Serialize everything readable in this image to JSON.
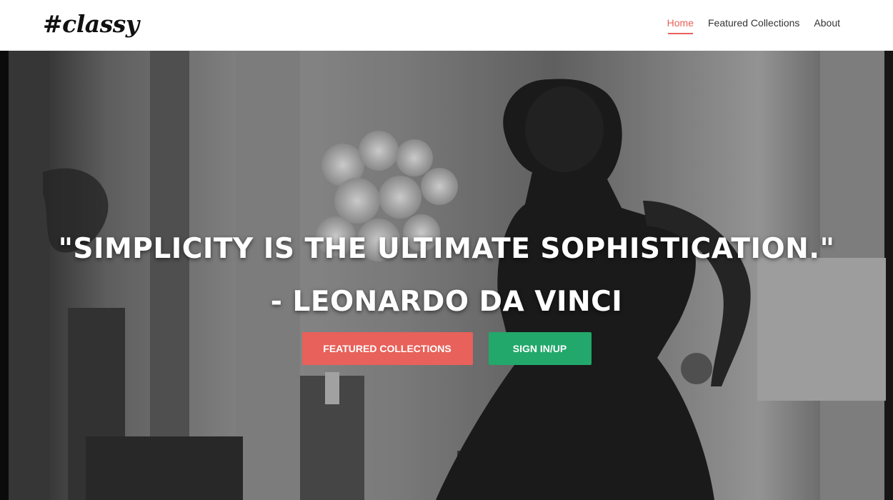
{
  "header": {
    "logo": "#classy",
    "nav": [
      {
        "label": "Home",
        "active": true
      },
      {
        "label": "Featured Collections",
        "active": false
      },
      {
        "label": "About",
        "active": false
      }
    ]
  },
  "hero": {
    "quote_line1": "\"Simplicity is the ultimate sophistication.\"",
    "quote_line2": "- Leonardo da Vinci",
    "buttons": {
      "featured": "Featured Collections",
      "signin": "Sign in/up"
    }
  },
  "colors": {
    "accent": "#e8615a",
    "green": "#22a86b",
    "nav_text": "#333333"
  }
}
